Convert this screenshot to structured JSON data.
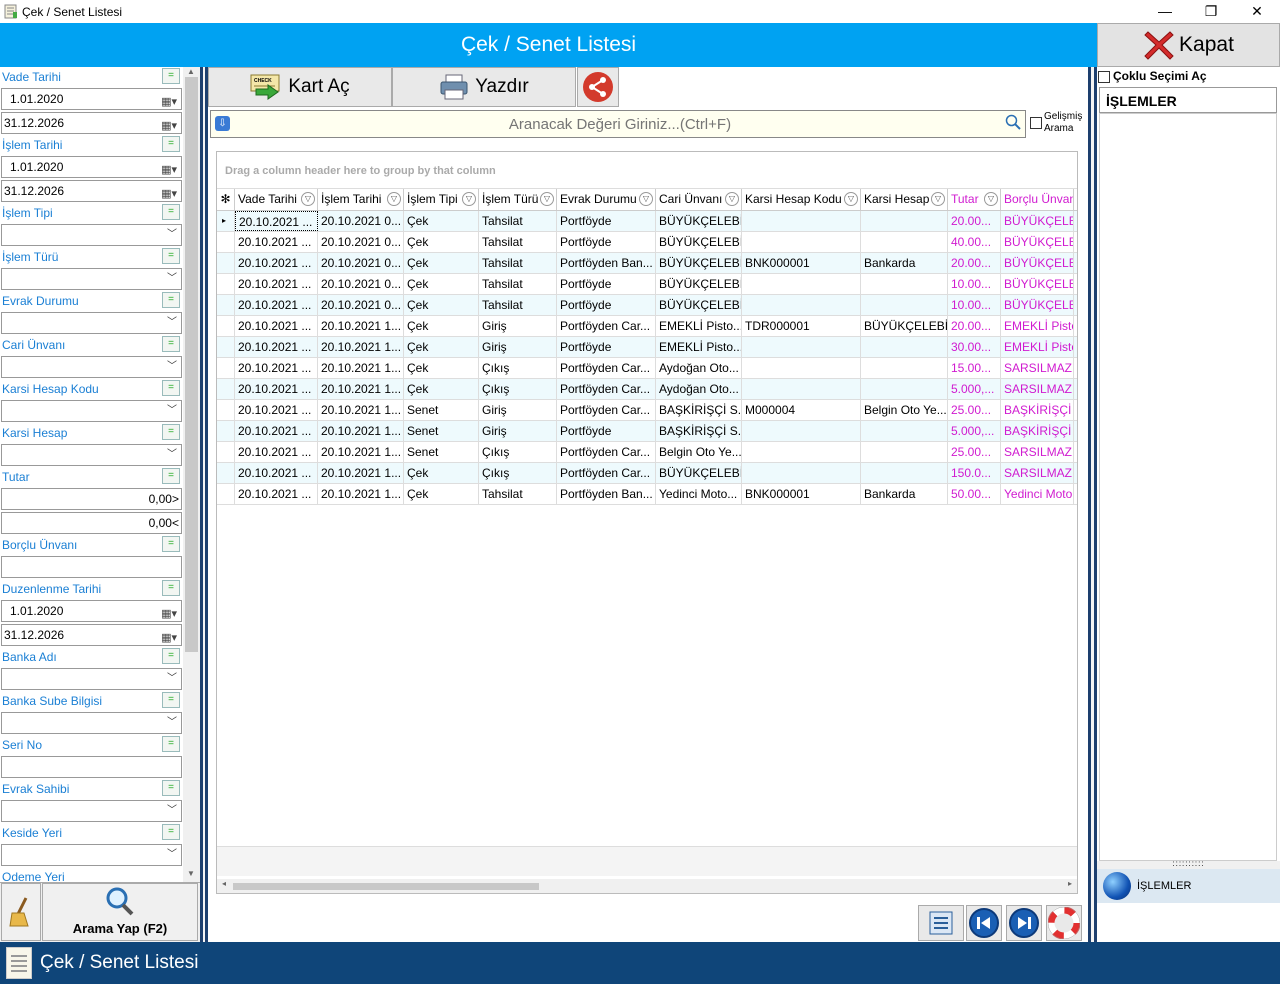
{
  "window": {
    "title": "Çek / Senet Listesi",
    "minimize": "—",
    "maximize": "❐",
    "close": "✕"
  },
  "header": {
    "title": "Çek / Senet Listesi",
    "close_label": "Kapat"
  },
  "filters": {
    "vade_tarihi": {
      "label": "Vade Tarihi",
      "from": "1.01.2020",
      "to": "31.12.2026"
    },
    "islem_tarihi": {
      "label": "İşlem Tarihi",
      "from": "1.01.2020",
      "to": "31.12.2026"
    },
    "islem_tipi": {
      "label": "İşlem Tipi",
      "value": ""
    },
    "islem_turu": {
      "label": "İşlem Türü",
      "value": ""
    },
    "evrak_durumu": {
      "label": "Evrak Durumu",
      "value": ""
    },
    "cari_unvani": {
      "label": "Cari Ünvanı",
      "value": ""
    },
    "karsi_hesap_kodu": {
      "label": "Karsi Hesap Kodu",
      "value": ""
    },
    "karsi_hesap": {
      "label": "Karsi Hesap",
      "value": ""
    },
    "tutar": {
      "label": "Tutar",
      "min": "0,00>",
      "max": "0,00<"
    },
    "borclu_unvani": {
      "label": "Borçlu Ünvanı",
      "value": ""
    },
    "duzenlenme_tarihi": {
      "label": "Duzenlenme Tarihi",
      "from": "1.01.2020",
      "to": "31.12.2026"
    },
    "banka_adi": {
      "label": "Banka Adı",
      "value": ""
    },
    "banka_sube": {
      "label": "Banka Sube Bilgisi",
      "value": ""
    },
    "seri_no": {
      "label": "Seri No",
      "value": ""
    },
    "evrak_sahibi": {
      "label": "Evrak Sahibi",
      "value": ""
    },
    "keside_yeri": {
      "label": "Keside Yeri",
      "value": ""
    },
    "odeme_yeri": {
      "label": "Odeme Yeri"
    }
  },
  "search_button": {
    "label": "Arama Yap (F2)"
  },
  "toolbar": {
    "kart_ac": "Kart Aç",
    "yazdir": "Yazdır",
    "check_icon_text": "CHECK"
  },
  "search": {
    "placeholder": "Aranacak Değeri Giriniz...(Ctrl+F)",
    "advanced_label_1": "Gelişmiş",
    "advanced_label_2": "Arama"
  },
  "grid": {
    "group_hint": "Drag a column header here to group by that column",
    "columns": [
      "Vade Tarihi",
      "İşlem Tarihi",
      "İşlem Tipi",
      "İşlem Türü",
      "Evrak Durumu",
      "Cari Ünvanı",
      "Karsi Hesap Kodu",
      "Karsi Hesap",
      "Tutar",
      "Borçlu Ünvanı"
    ],
    "rows": [
      [
        "20.10.2021 ...",
        "20.10.2021 0...",
        "Çek",
        "Tahsilat",
        "Portföyde",
        "BÜYÜKÇELEBİ...",
        "",
        "",
        "20.00...",
        "BÜYÜKÇELEBİ"
      ],
      [
        "20.10.2021 ...",
        "20.10.2021 0...",
        "Çek",
        "Tahsilat",
        "Portföyde",
        "BÜYÜKÇELEBİ...",
        "",
        "",
        "40.00...",
        "BÜYÜKÇELEBİ"
      ],
      [
        "20.10.2021 ...",
        "20.10.2021 0...",
        "Çek",
        "Tahsilat",
        "Portföyden Ban...",
        "BÜYÜKÇELEBİ...",
        "BNK000001",
        "Bankarda",
        "20.00...",
        "BÜYÜKÇELEBİ"
      ],
      [
        "20.10.2021 ...",
        "20.10.2021 0...",
        "Çek",
        "Tahsilat",
        "Portföyde",
        "BÜYÜKÇELEBİ...",
        "",
        "",
        "10.00...",
        "BÜYÜKÇELEBİ"
      ],
      [
        "20.10.2021 ...",
        "20.10.2021 0...",
        "Çek",
        "Tahsilat",
        "Portföyde",
        "BÜYÜKÇELEBİ...",
        "",
        "",
        "10.00...",
        "BÜYÜKÇELEBİ"
      ],
      [
        "20.10.2021 ...",
        "20.10.2021 1...",
        "Çek",
        "Giriş",
        "Portföyden Car...",
        "EMEKLİ Pisto...",
        "TDR000001",
        "BÜYÜKÇELEBİ ...",
        "20.00...",
        "EMEKLİ Pisto"
      ],
      [
        "20.10.2021 ...",
        "20.10.2021 1...",
        "Çek",
        "Giriş",
        "Portföyde",
        "EMEKLİ Pisto...",
        "",
        "",
        "30.00...",
        "EMEKLİ Pisto"
      ],
      [
        "20.10.2021 ...",
        "20.10.2021 1...",
        "Çek",
        "Çıkış",
        "Portföyden Car...",
        "Aydoğan Oto...",
        "",
        "",
        "15.00...",
        "SARSILMAZ"
      ],
      [
        "20.10.2021 ...",
        "20.10.2021 1...",
        "Çek",
        "Çıkış",
        "Portföyden Car...",
        "Aydoğan Oto...",
        "",
        "",
        "5.000,...",
        "SARSILMAZ"
      ],
      [
        "20.10.2021 ...",
        "20.10.2021 1...",
        "Senet",
        "Giriş",
        "Portföyden Car...",
        "BAŞKİRİŞÇİ S...",
        "M000004",
        "Belgin Oto Ye...",
        "25.00...",
        "BAŞKİRİŞÇİ S"
      ],
      [
        "20.10.2021 ...",
        "20.10.2021 1...",
        "Senet",
        "Giriş",
        "Portföyde",
        "BAŞKİRİŞÇİ S...",
        "",
        "",
        "5.000,...",
        "BAŞKİRİŞÇİ S"
      ],
      [
        "20.10.2021 ...",
        "20.10.2021 1...",
        "Senet",
        "Çıkış",
        "Portföyden Car...",
        "Belgin Oto Ye...",
        "",
        "",
        "25.00...",
        "SARSILMAZ"
      ],
      [
        "20.10.2021 ...",
        "20.10.2021 1...",
        "Çek",
        "Çıkış",
        "Portföyden Car...",
        "BÜYÜKÇELEBİ...",
        "",
        "",
        "150.0...",
        "SARSILMAZ"
      ],
      [
        "20.10.2021 ...",
        "20.10.2021 1...",
        "Çek",
        "Tahsilat",
        "Portföyden Ban...",
        "Yedinci Moto...",
        "BNK000001",
        "Bankarda",
        "50.00...",
        "Yedinci Moto"
      ]
    ]
  },
  "right_panel": {
    "multi_select_label": "Çoklu Seçimi Aç",
    "islemler_header": "İŞLEMLER",
    "islemler_item": "İŞLEMLER"
  },
  "statusbar": {
    "title": "Çek / Senet Listesi"
  },
  "colors": {
    "header_blue": "#00a2f2",
    "status_navy": "#0f4579",
    "accent_pink": "#d01bd0",
    "label_blue": "#1a7fd4"
  }
}
